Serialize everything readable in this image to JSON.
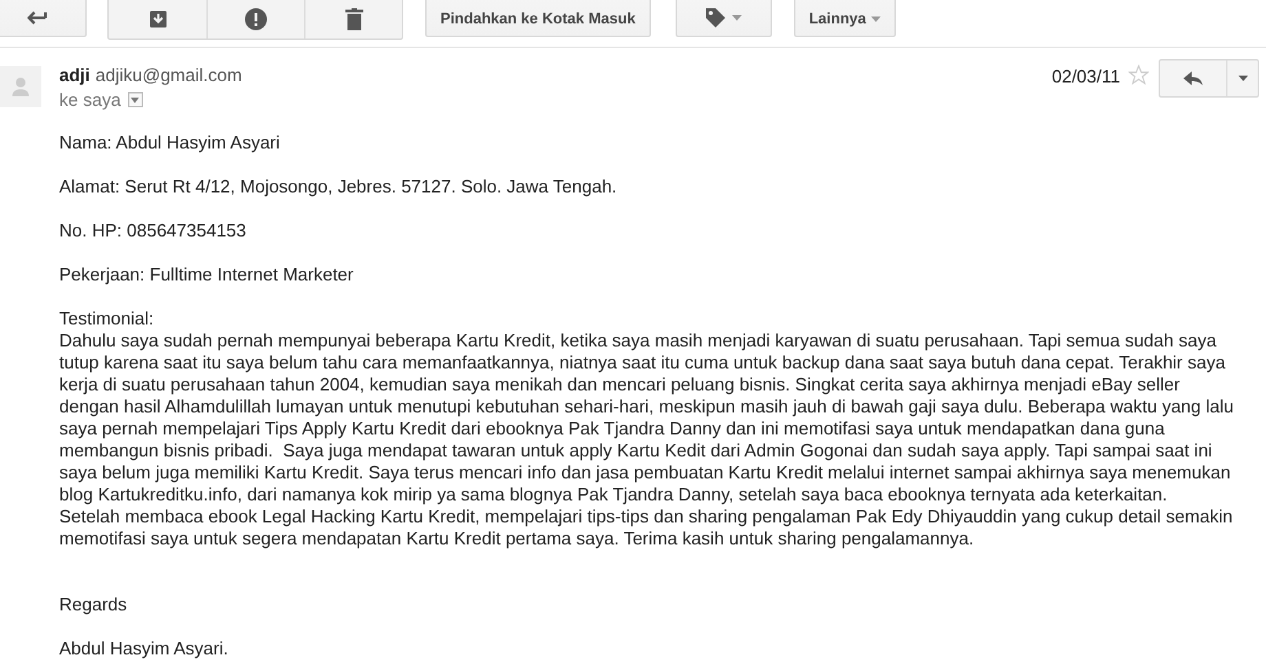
{
  "toolbar": {
    "move_button": "Pindahkan ke Kotak Masuk",
    "more_button": "Lainnya"
  },
  "message": {
    "sender_name": "adji",
    "sender_email": "adjiku@gmail.com",
    "recipient": "ke saya",
    "date": "02/03/11",
    "starred": false,
    "fields": [
      "Nama: Abdul Hasyim Asyari",
      "Alamat: Serut Rt 4/12, Mojosongo, Jebres. 57127. Solo. Jawa Tengah.",
      "No. HP: 085647354153",
      "Pekerjaan: Fulltime Internet Marketer"
    ],
    "testimonial_label": "Testimonial:",
    "testimonial_lines": [
      "Dahulu saya sudah pernah mempunyai beberapa Kartu Kredit, ketika saya masih menjadi karyawan di suatu perusahaan. Tapi semua sudah saya",
      "tutup karena saat itu saya belum tahu cara memanfaatkannya, niatnya saat itu cuma untuk backup dana saat saya butuh dana cepat. Terakhir saya",
      "kerja di suatu perusahaan tahun 2004, kemudian saya menikah dan mencari peluang bisnis. Singkat cerita saya akhirnya menjadi eBay seller",
      "dengan hasil Alhamdulillah lumayan untuk menutupi kebutuhan sehari-hari, meskipun masih jauh di bawah gaji saya dulu. Beberapa waktu yang lalu",
      "saya pernah mempelajari Tips Apply Kartu Kredit dari ebooknya Pak Tjandra Danny dan ini memotifasi saya untuk mendapatkan dana guna",
      "membangun bisnis pribadi.  Saya juga mendapat tawaran untuk apply Kartu Kedit dari Admin Gogonai dan sudah saya apply. Tapi sampai saat ini",
      "saya belum juga memiliki Kartu Kredit. Saya terus mencari info dan jasa pembuatan Kartu Kredit melalui internet sampai akhirnya saya menemukan",
      "blog Kartukreditku.info, dari namanya kok mirip ya sama blognya Pak Tjandra Danny, setelah saya baca ebooknya ternyata ada keterkaitan.",
      "Setelah membaca ebook Legal Hacking Kartu Kredit, mempelajari tips-tips dan sharing pengalaman Pak Edy Dhiyauddin yang cukup detail semakin",
      "memotifasi saya untuk segera mendapatan Kartu Kredit pertama saya. Terima kasih untuk sharing pengalamannya."
    ],
    "closing": "Regards",
    "signature": "Abdul Hasyim Asyari."
  }
}
